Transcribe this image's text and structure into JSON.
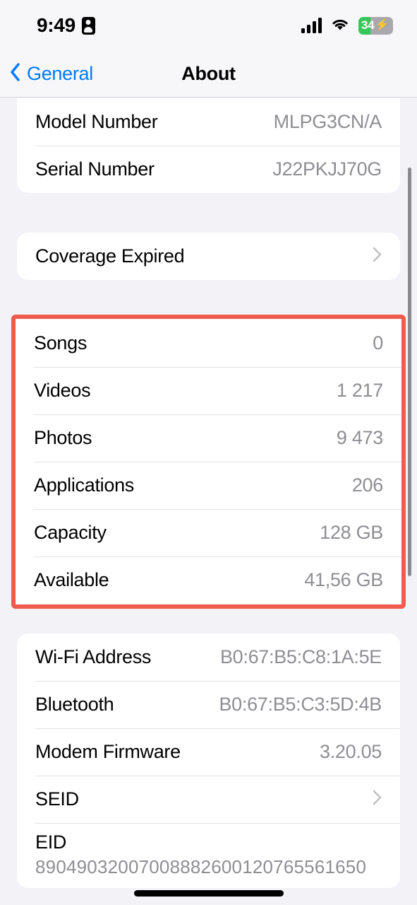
{
  "status_bar": {
    "time": "9:49",
    "recording_badge_icon": "person-badge-icon",
    "cellular_icon": "signal-bars-icon",
    "wifi_icon": "wifi-icon",
    "battery_percent": "34",
    "battery_level": 34,
    "battery_charging_icon": "bolt-icon",
    "battery_fill_color": "#34c759"
  },
  "nav": {
    "back_label": "General",
    "back_icon": "chevron-left-icon",
    "title": "About",
    "accent_color": "#007aff"
  },
  "highlight": {
    "color": "#ef5b4c"
  },
  "sections": {
    "identity": {
      "rows": [
        {
          "label": "Model Number",
          "value": "MLPG3CN/A"
        },
        {
          "label": "Serial Number",
          "value": "J22PKJJ70G"
        }
      ]
    },
    "coverage": {
      "rows": [
        {
          "label": "Coverage Expired",
          "value": "",
          "accessory": "chevron-right-icon"
        }
      ]
    },
    "storage": {
      "highlighted": true,
      "rows": [
        {
          "label": "Songs",
          "value": "0"
        },
        {
          "label": "Videos",
          "value": "1 217"
        },
        {
          "label": "Photos",
          "value": "9 473"
        },
        {
          "label": "Applications",
          "value": "206"
        },
        {
          "label": "Capacity",
          "value": "128 GB"
        },
        {
          "label": "Available",
          "value": "41,56 GB"
        }
      ]
    },
    "network": {
      "rows": [
        {
          "label": "Wi-Fi Address",
          "value": "B0:67:B5:C8:1A:5E"
        },
        {
          "label": "Bluetooth",
          "value": "B0:67:B5:C3:5D:4B"
        },
        {
          "label": "Modem Firmware",
          "value": "3.20.05"
        },
        {
          "label": "SEID",
          "value": "",
          "accessory": "chevron-right-icon"
        },
        {
          "label": "EID",
          "value": "89049032007008882600120765561650"
        }
      ]
    }
  }
}
